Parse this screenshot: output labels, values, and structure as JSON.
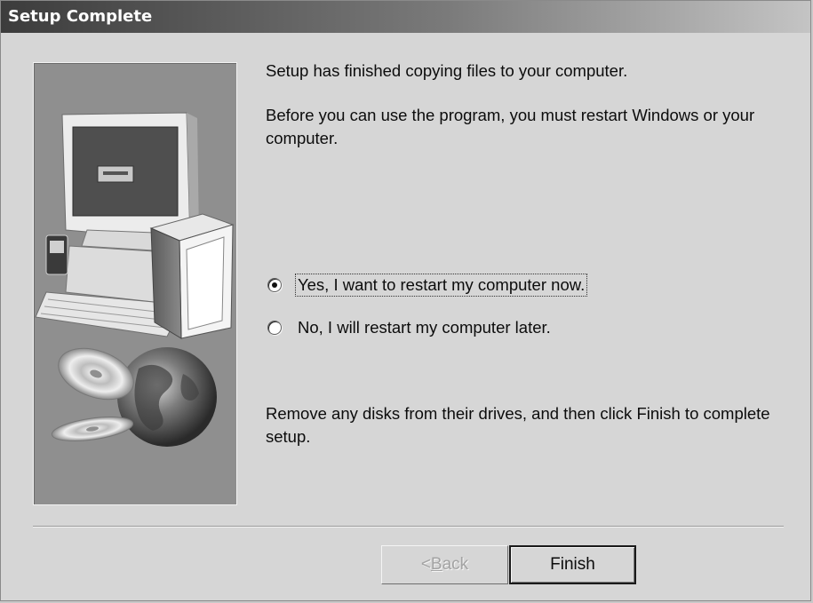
{
  "window": {
    "title": "Setup Complete"
  },
  "message": {
    "line1": "Setup has finished copying files to your computer.",
    "line2": "Before you can use the program, you must restart Windows or your computer.",
    "line3": "Remove any disks from their drives, and then click Finish to complete setup."
  },
  "options": {
    "restart_now": {
      "label": "Yes, I want to restart my computer now.",
      "selected": true
    },
    "restart_later": {
      "label": "No, I will restart my computer later.",
      "selected": false
    }
  },
  "buttons": {
    "back_mnemonic": "B",
    "back_rest": "ack",
    "back_prefix": "< ",
    "back_enabled": false,
    "finish": "Finish"
  },
  "art": {
    "icons": [
      "computer-monitor-icon",
      "keyboard-icon",
      "software-box-icon",
      "cd-disc-icon",
      "globe-icon"
    ]
  }
}
